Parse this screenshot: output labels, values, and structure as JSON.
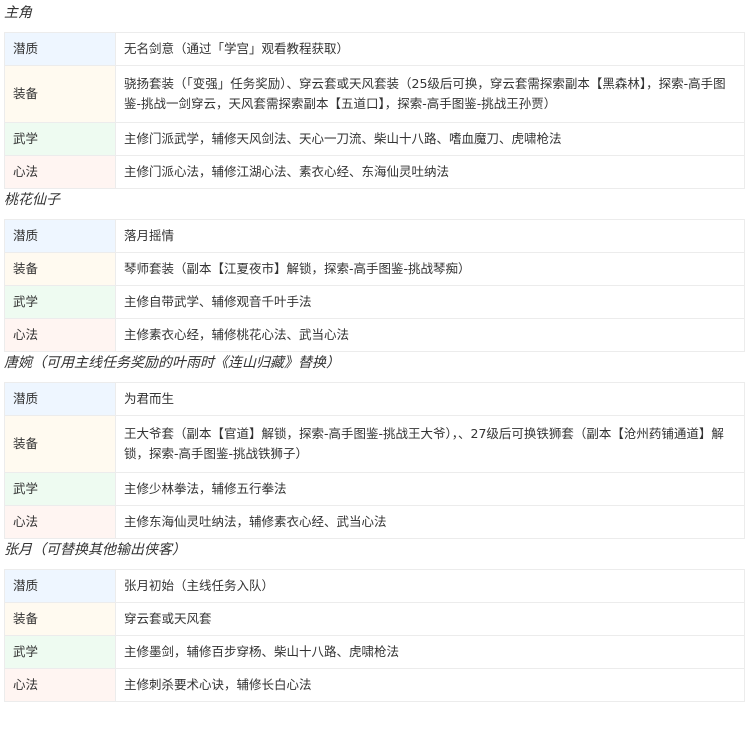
{
  "sections": [
    {
      "title": "主角",
      "rows": [
        {
          "label": "潜质",
          "value": "无名剑意（通过「学宫」观看教程获取）"
        },
        {
          "label": "装备",
          "value": "骁扬套装（「变强」任务奖励）、穿云套或天风套装（25级后可换，穿云套需探索副本【黑森林】，探索-高手图鉴-挑战一剑穿云，天风套需探索副本【五道口】，探索-高手图鉴-挑战王孙贾）"
        },
        {
          "label": "武学",
          "value": "主修门派武学，辅修天风剑法、天心一刀流、柴山十八路、嗜血魔刀、虎啸枪法"
        },
        {
          "label": "心法",
          "value": "主修门派心法，辅修江湖心法、素衣心经、东海仙灵吐纳法"
        }
      ]
    },
    {
      "title": "桃花仙子",
      "rows": [
        {
          "label": "潜质",
          "value": "落月摇情"
        },
        {
          "label": "装备",
          "value": "琴师套装（副本【江夏夜市】解锁，探索-高手图鉴-挑战琴痴）"
        },
        {
          "label": "武学",
          "value": "主修自带武学、辅修观音千叶手法"
        },
        {
          "label": "心法",
          "value": "主修素衣心经，辅修桃花心法、武当心法"
        }
      ]
    },
    {
      "title": "唐婉（可用主线任务奖励的叶雨时《连山归藏》替换）",
      "rows": [
        {
          "label": "潜质",
          "value": "为君而生"
        },
        {
          "label": "装备",
          "value": "王大爷套（副本【官道】解锁，探索-高手图鉴-挑战王大爷），、27级后可换铁狮套（副本【沧州药铺通道】解锁，探索-高手图鉴-挑战铁狮子）"
        },
        {
          "label": "武学",
          "value": "主修少林拳法，辅修五行拳法"
        },
        {
          "label": "心法",
          "value": "主修东海仙灵吐纳法，辅修素衣心经、武当心法"
        }
      ]
    },
    {
      "title": "张月（可替换其他输出侠客）",
      "rows": [
        {
          "label": "潜质",
          "value": "张月初始（主线任务入队）"
        },
        {
          "label": "装备",
          "value": "穿云套或天风套"
        },
        {
          "label": "武学",
          "value": "主修墨剑，辅修百步穿杨、柴山十八路、虎啸枪法"
        },
        {
          "label": "心法",
          "value": "主修刺杀要术心诀，辅修长白心法"
        }
      ]
    }
  ]
}
